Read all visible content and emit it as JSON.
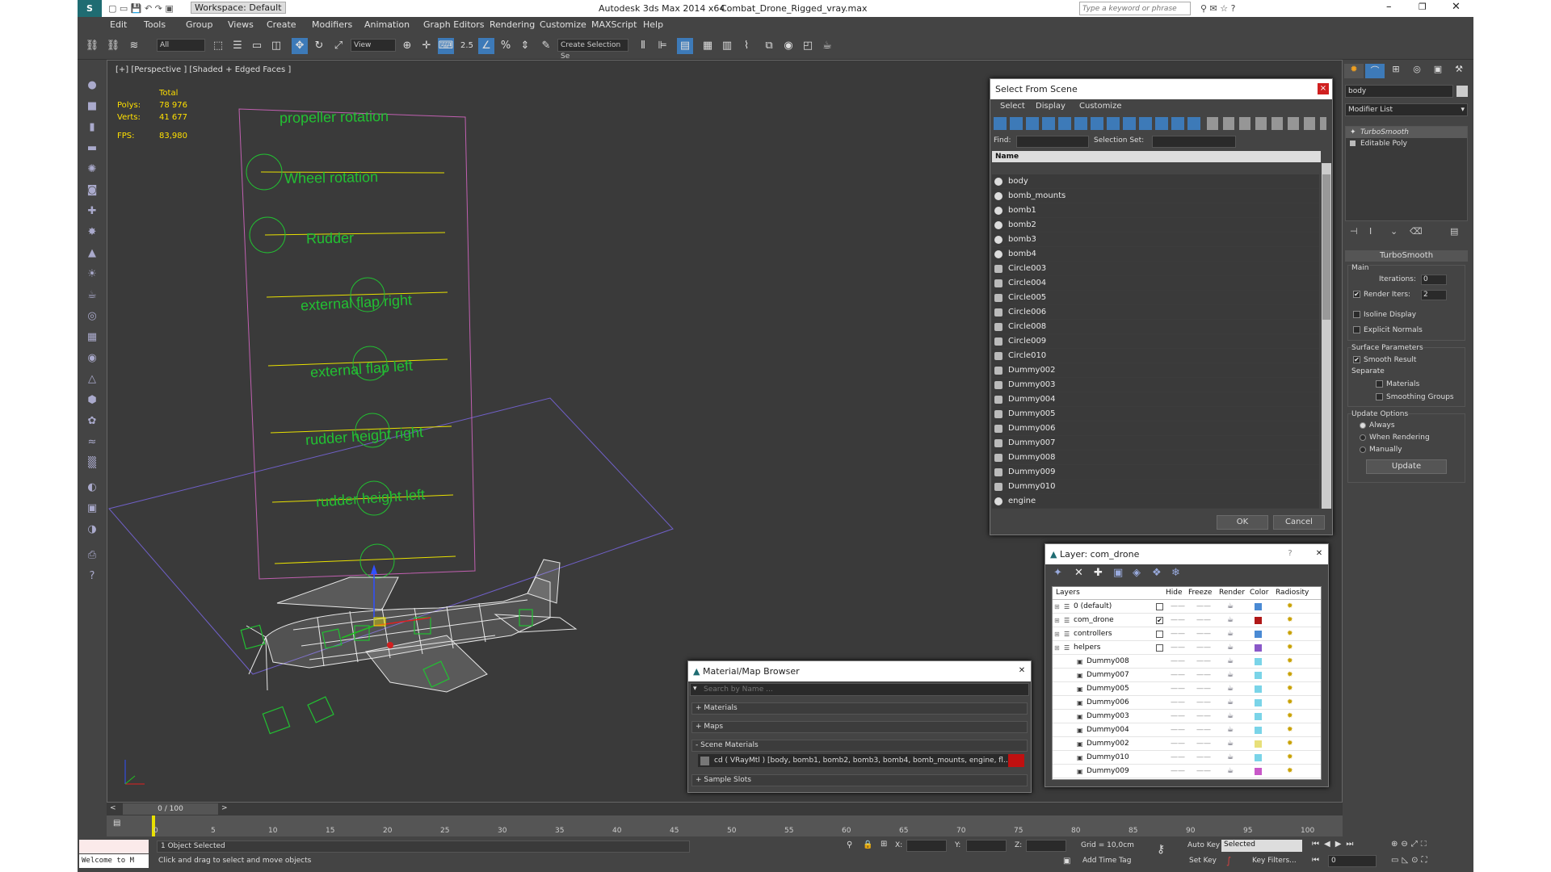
{
  "titlebar": {
    "workspace": "Workspace: Default",
    "app_title": "Autodesk 3ds Max  2014 x64",
    "file_name": "Combat_Drone_Rigged_vray.max",
    "search_placeholder": "Type a keyword or phrase"
  },
  "menu": [
    "Edit",
    "Tools",
    "Group",
    "Views",
    "Create",
    "Modifiers",
    "Animation",
    "Graph Editors",
    "Rendering",
    "Customize",
    "MAXScript",
    "Help"
  ],
  "toolbar": {
    "filter": "All",
    "ref_coord": "View",
    "snap_value": "2.5",
    "selection_set": "Create Selection Se"
  },
  "viewport": {
    "label": "[+] [Perspective ] [Shaded + Edged Faces ]",
    "stats": {
      "total": "Total",
      "polys_label": "Polys:",
      "polys": "78 976",
      "verts_label": "Verts:",
      "verts": "41 677",
      "fps_label": "FPS:",
      "fps": "83,980"
    },
    "controls": [
      "propeller rotation",
      "Wheel rotation",
      "Rudder",
      "external flap right",
      "external flap left",
      "rudder height right",
      "rudder height left"
    ]
  },
  "select_scene": {
    "title": "Select From Scene",
    "menu": [
      "Select",
      "Display",
      "Customize"
    ],
    "find_label": "Find:",
    "selset_label": "Selection Set:",
    "col_name": "Name",
    "items": [
      "body",
      "bomb_mounts",
      "bomb1",
      "bomb2",
      "bomb3",
      "bomb4",
      "Circle003",
      "Circle004",
      "Circle005",
      "Circle006",
      "Circle008",
      "Circle009",
      "Circle010",
      "Dummy002",
      "Dummy003",
      "Dummy004",
      "Dummy005",
      "Dummy006",
      "Dummy007",
      "Dummy008",
      "Dummy009",
      "Dummy010",
      "engine"
    ],
    "ok": "OK",
    "cancel": "Cancel"
  },
  "layer": {
    "title": "Layer: com_drone",
    "help": "?",
    "cols": [
      "Layers",
      "Hide",
      "Freeze",
      "Render",
      "Color",
      "Radiosity"
    ],
    "rows": [
      {
        "name": "0 (default)",
        "indent": 0,
        "color": "#4a8ad4"
      },
      {
        "name": "com_drone",
        "indent": 0,
        "color": "#b01818"
      },
      {
        "name": "controllers",
        "indent": 0,
        "color": "#4a8ad4"
      },
      {
        "name": "helpers",
        "indent": 0,
        "color": "#8a58c8"
      },
      {
        "name": "Dummy008",
        "indent": 1,
        "color": "#7ad4e8"
      },
      {
        "name": "Dummy007",
        "indent": 1,
        "color": "#7ad4e8"
      },
      {
        "name": "Dummy005",
        "indent": 1,
        "color": "#7ad4e8"
      },
      {
        "name": "Dummy006",
        "indent": 1,
        "color": "#7ad4e8"
      },
      {
        "name": "Dummy003",
        "indent": 1,
        "color": "#7ad4e8"
      },
      {
        "name": "Dummy004",
        "indent": 1,
        "color": "#7ad4e8"
      },
      {
        "name": "Dummy002",
        "indent": 1,
        "color": "#e8e07a"
      },
      {
        "name": "Dummy010",
        "indent": 1,
        "color": "#7ad4e8"
      },
      {
        "name": "Dummy009",
        "indent": 1,
        "color": "#c858c8"
      }
    ]
  },
  "material": {
    "title": "Material/Map Browser",
    "search_placeholder": "Search by Name ...",
    "groups": [
      "+ Materials",
      "+ Maps",
      "- Scene Materials"
    ],
    "scene_item": "cd  ( VRayMtl ) [body, bomb1, bomb2, bomb3, bomb4, bomb_mounts, engine, fl...",
    "sample_slots": "+ Sample Slots"
  },
  "cmdpanel": {
    "object_name": "body",
    "modifier_list": "Modifier List",
    "stack": [
      "TurboSmooth",
      "Editable Poly"
    ],
    "rollout_title": "TurboSmooth",
    "main": "Main",
    "iterations_label": "Iterations:",
    "iterations": "0",
    "render_iters_label": "Render Iters:",
    "render_iters": "2",
    "isoline": "Isoline Display",
    "explicit": "Explicit Normals",
    "surface": "Surface Parameters",
    "smooth_result": "Smooth Result",
    "separate": "Separate",
    "materials": "Materials",
    "smoothing": "Smoothing Groups",
    "update_options": "Update Options",
    "always": "Always",
    "when_rendering": "When Rendering",
    "manually": "Manually",
    "update": "Update"
  },
  "timeline": {
    "frame": "0 / 100",
    "ticks": [
      "0",
      "5",
      "10",
      "15",
      "20",
      "25",
      "30",
      "35",
      "40",
      "45",
      "50",
      "55",
      "60",
      "65",
      "70",
      "75",
      "80",
      "85",
      "90",
      "95",
      "100"
    ]
  },
  "status": {
    "welcome": "Welcome to M",
    "selected": "1 Object Selected",
    "prompt": "Click and drag to select and move objects",
    "x_label": "X:",
    "y_label": "Y:",
    "z_label": "Z:",
    "grid": "Grid = 10,0cm",
    "add_time_tag": "Add Time Tag",
    "auto_key": "Auto Key",
    "set_key": "Set Key",
    "selected_mode": "Selected",
    "key_filters": "Key Filters...",
    "frame_field": "0"
  },
  "colors": {
    "accent": "#3d7ab8",
    "wire_pink": "#c060b0",
    "ctrl_green": "#22c032",
    "gizmo_yellow": "#e8e000"
  }
}
